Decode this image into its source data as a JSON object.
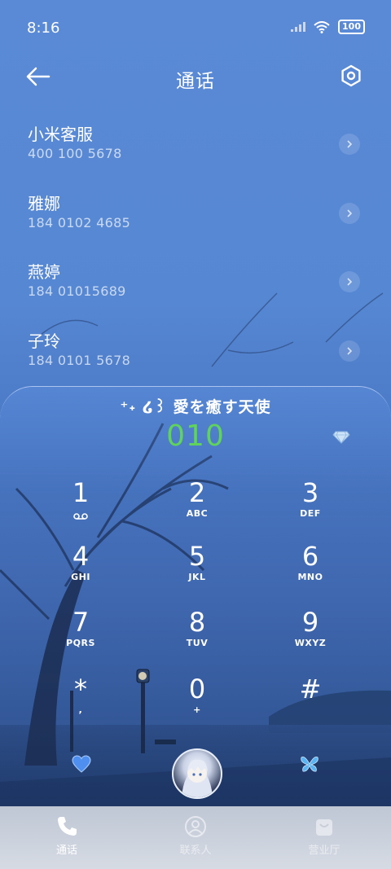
{
  "status_bar": {
    "time": "8:16",
    "battery": "100"
  },
  "header": {
    "title": "通话"
  },
  "recent_calls": [
    {
      "name": "小米客服",
      "number": "400 100 5678"
    },
    {
      "name": "雅娜",
      "number": "184 0102 4685"
    },
    {
      "name": "燕婷",
      "number": "184 01015689"
    },
    {
      "name": "子玲",
      "number": "184 0101 5678"
    }
  ],
  "dialer": {
    "signature": "⁺˖ ໒꒱ 愛を癒す天使",
    "entered_number": "010",
    "keys": [
      {
        "num": "1",
        "letters": ""
      },
      {
        "num": "2",
        "letters": "ABC"
      },
      {
        "num": "3",
        "letters": "DEF"
      },
      {
        "num": "4",
        "letters": "GHI"
      },
      {
        "num": "5",
        "letters": "JKL"
      },
      {
        "num": "6",
        "letters": "MNO"
      },
      {
        "num": "7",
        "letters": "PQRS"
      },
      {
        "num": "8",
        "letters": "TUV"
      },
      {
        "num": "9",
        "letters": "WXYZ"
      },
      {
        "num": "*",
        "letters": ","
      },
      {
        "num": "0",
        "letters": "+"
      },
      {
        "num": "#",
        "letters": ""
      }
    ]
  },
  "bottom_nav": [
    {
      "label": "通话",
      "icon": "phone-icon"
    },
    {
      "label": "联系人",
      "icon": "contacts-icon"
    },
    {
      "label": "营业厅",
      "icon": "store-icon"
    }
  ],
  "colors": {
    "entered_number": "#5fd35c",
    "background_top": "#5a8ad6",
    "background_bottom": "#243f72"
  }
}
